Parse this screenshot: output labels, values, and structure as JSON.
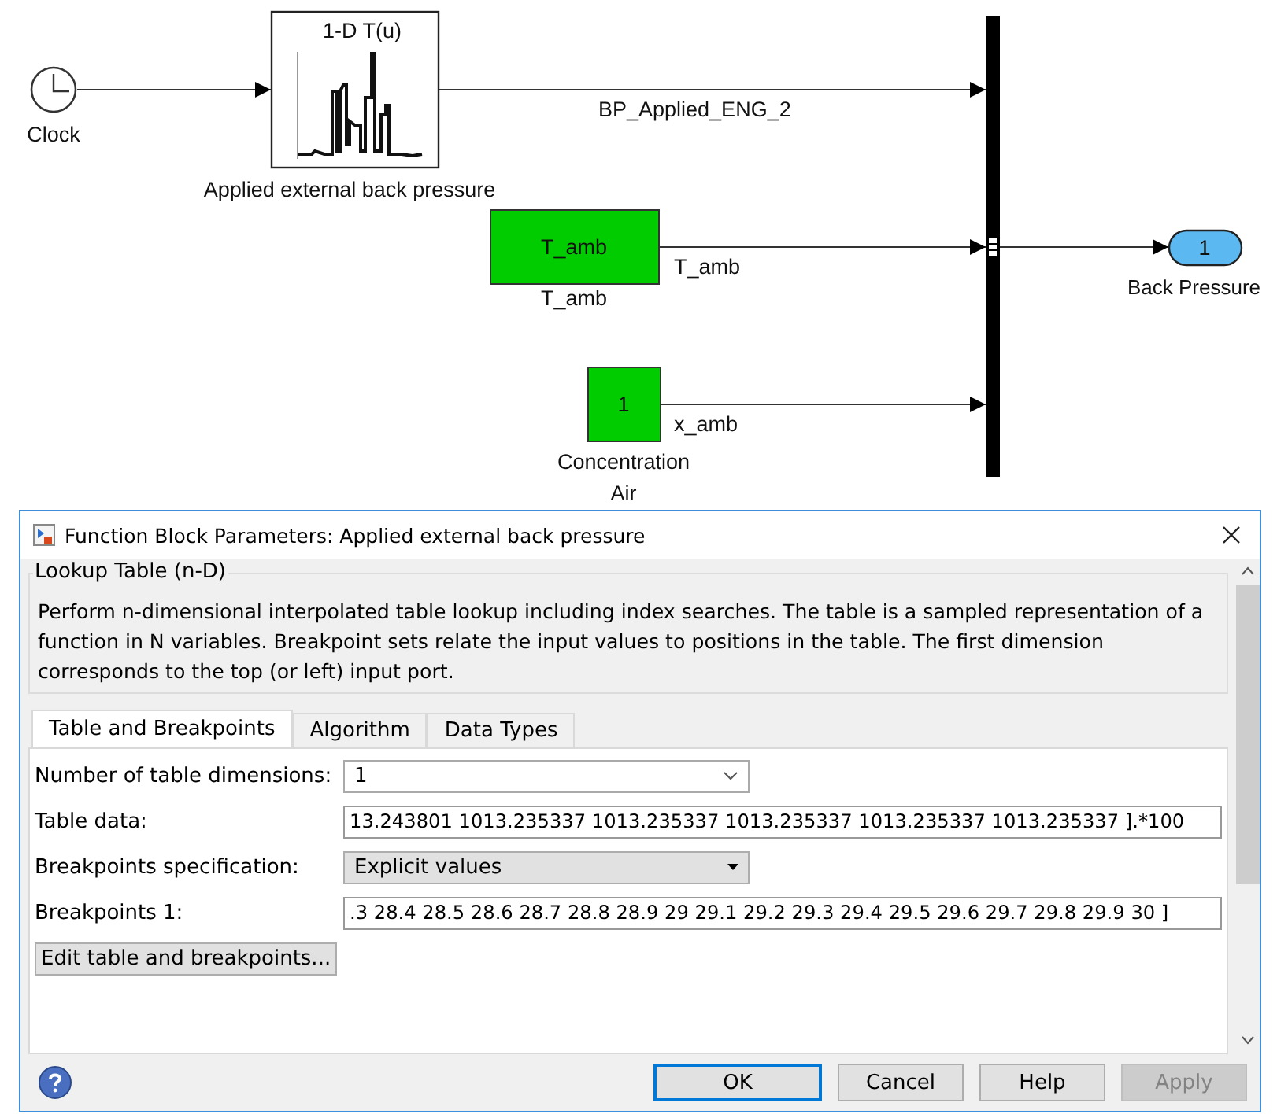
{
  "diagram": {
    "clock": {
      "label": "Clock"
    },
    "lookup_block": {
      "title": "1-D T(u)",
      "label": "Applied external back pressure",
      "signal": "BP_Applied_ENG_2"
    },
    "constants": [
      {
        "value": "T_amb",
        "label_lines": [
          "T_amb"
        ],
        "signal": "T_amb"
      },
      {
        "value": "1",
        "label_lines": [
          "Concentration",
          "Air"
        ],
        "signal": "x_amb"
      }
    ],
    "outport": {
      "number": "1",
      "label": "Back Pressure"
    }
  },
  "window": {
    "title": "Function Block Parameters: Applied external back pressure"
  },
  "group": {
    "title": "Lookup Table (n-D)",
    "description": "Perform n-dimensional interpolated table lookup including index searches. The table is a sampled representation of a function in N variables. Breakpoint sets relate the input values to positions in the table. The first dimension corresponds to the top (or left) input port."
  },
  "tabs": [
    {
      "label": "Table and Breakpoints",
      "selected": true
    },
    {
      "label": "Algorithm",
      "selected": false
    },
    {
      "label": "Data Types",
      "selected": false
    }
  ],
  "fields": [
    {
      "kind": "combo",
      "label": "Number of table dimensions:",
      "value": "1"
    },
    {
      "kind": "text",
      "label": "Table data:",
      "value": "13.243801 1013.235337 1013.235337 1013.235337 1013.235337 1013.235337 ].*100"
    },
    {
      "kind": "popup",
      "label": "Breakpoints specification:",
      "value": "Explicit values"
    },
    {
      "kind": "text",
      "label": "Breakpoints 1:",
      "value": ".3 28.4 28.5 28.6 28.7 28.8 28.9 29 29.1 29.2 29.3 29.4 29.5 29.6 29.7 29.8 29.9 30 ]"
    }
  ],
  "edit_button": "Edit table and breakpoints...",
  "buttons": [
    {
      "label": "OK",
      "default": true,
      "disabled": false
    },
    {
      "label": "Cancel",
      "default": false,
      "disabled": false
    },
    {
      "label": "Help",
      "default": false,
      "disabled": false
    },
    {
      "label": "Apply",
      "default": false,
      "disabled": true
    }
  ]
}
